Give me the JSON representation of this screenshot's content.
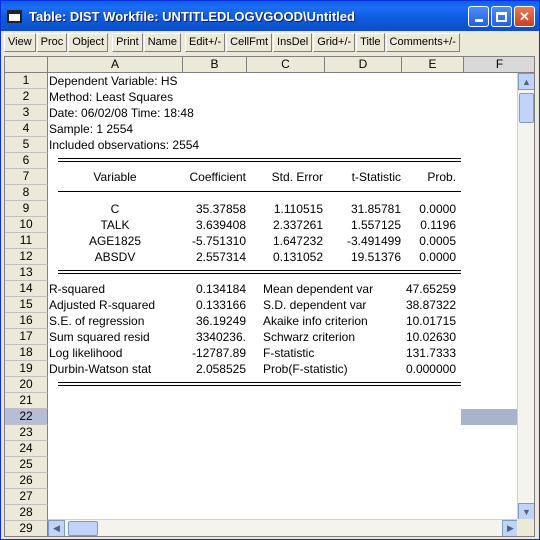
{
  "window": {
    "title": "Table: DIST    Workfile: UNTITLEDLOGVGOOD\\Untitled"
  },
  "toolbar": [
    "View",
    "Proc",
    "Object",
    "Print",
    "Name",
    "Edit+/-",
    "CellFmt",
    "InsDel",
    "Grid+/-",
    "Title",
    "Comments+/-"
  ],
  "columns": [
    "A",
    "B",
    "C",
    "D",
    "E",
    "F"
  ],
  "rows": [
    "1",
    "2",
    "3",
    "4",
    "5",
    "6",
    "7",
    "8",
    "9",
    "10",
    "11",
    "12",
    "13",
    "14",
    "15",
    "16",
    "17",
    "18",
    "19",
    "20",
    "21",
    "22",
    "23",
    "24",
    "25",
    "26",
    "27",
    "28",
    "29"
  ],
  "selected": {
    "column": "F",
    "row": "22"
  },
  "header": {
    "dep": "Dependent Variable: HS",
    "method": "Method: Least Squares",
    "date": "Date: 06/02/08   Time: 18:48",
    "sample": "Sample: 1 2554",
    "obs": "Included observations: 2554"
  },
  "coef_table": {
    "headers": [
      "Variable",
      "Coefficient",
      "Std. Error",
      "t-Statistic",
      "Prob."
    ],
    "rows": [
      [
        "C",
        "35.37858",
        "1.110515",
        "31.85781",
        "0.0000"
      ],
      [
        "TALK",
        "3.639408",
        "2.337261",
        "1.557125",
        "0.1196"
      ],
      [
        "AGE1825",
        "-5.751310",
        "1.647232",
        "-3.491499",
        "0.0005"
      ],
      [
        "ABSDV",
        "2.557314",
        "0.131052",
        "19.51376",
        "0.0000"
      ]
    ]
  },
  "stats": [
    [
      "R-squared",
      "0.134184",
      "Mean dependent var",
      "47.65259"
    ],
    [
      "Adjusted R-squared",
      "0.133166",
      "S.D. dependent var",
      "38.87322"
    ],
    [
      "S.E. of regression",
      "36.19249",
      "Akaike info criterion",
      "10.01715"
    ],
    [
      "Sum squared resid",
      "3340236.",
      "Schwarz criterion",
      "10.02630"
    ],
    [
      "Log likelihood",
      "-12787.89",
      "F-statistic",
      "131.7333"
    ],
    [
      "Durbin-Watson stat",
      "2.058525",
      "Prob(F-statistic)",
      "0.000000"
    ]
  ]
}
